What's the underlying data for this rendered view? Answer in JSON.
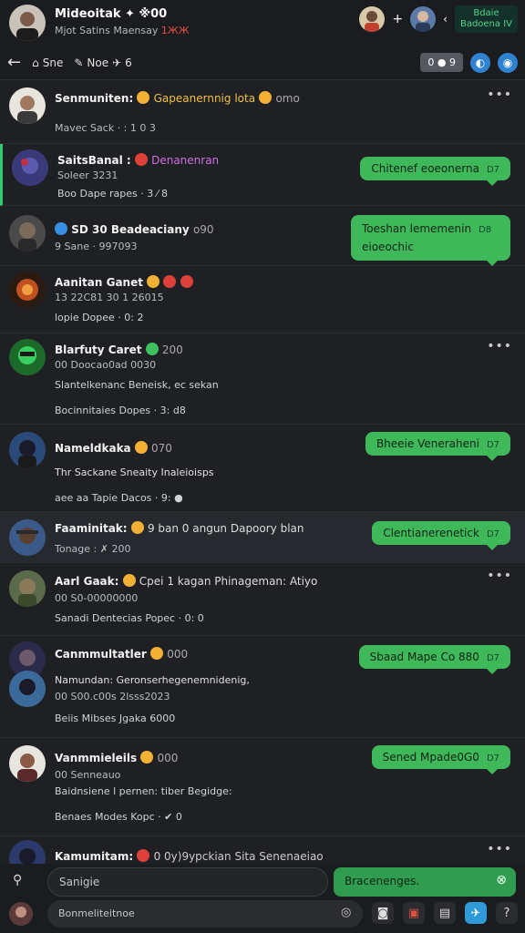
{
  "header": {
    "title": "Mideoitak ✦ ※00",
    "subtitle": "Mjot Satins Maensay",
    "subtitle_red": "1ЖЖ",
    "chip": "Bdaie\nBadoena IV"
  },
  "secbar": {
    "back_label": "←",
    "home_label": "Sne",
    "note_label": "Noe",
    "pill": "0 ● 9",
    "count": "6"
  },
  "rows": [
    {
      "name": "Senmuniten:",
      "tag": "Gapeanernnig lota",
      "tag2": "omo",
      "line2": "Mavec  Sack ·  : 1 0 3",
      "line3": "",
      "bubble": ""
    },
    {
      "name": "SaitsBanal :",
      "tag": "Denanenran",
      "line2": "Soleer 3231",
      "line3": "Boo  Dape  rapes · 3 ⁄ 8",
      "bubble": "Chitenef eoeonerna",
      "bubble_t": "D7"
    },
    {
      "name": "SD 30 Beadeaciany",
      "tag": "o90",
      "line2": "9 Sane · 997093",
      "line3": "",
      "bubble": "Toeshan lememenin",
      "bubble2": "eioeochic",
      "bubble_t": "D8"
    },
    {
      "name": "Aanitan Ganet",
      "tag": "",
      "line2": "13 22C81 30 1 26015",
      "line3": "lopie  Dopee · 0: 2",
      "bubble": ""
    },
    {
      "name": "Blarfuty Caret",
      "tag": "200",
      "line2": "00 Doocao0ad 0030",
      "line3a": "Slantelkenanc  Beneisk, ec  sekan",
      "line3": "Bocinnitaies  Dopes · 3: d8",
      "bubble": ""
    },
    {
      "name": "Nameldkaka",
      "tag": "070",
      "line2": "Thr Sackane Sneaity Inaleioisps",
      "line3": "aee aa  Tapie  Dacos · 9: ●",
      "bubble": "Bheeie Veneraheni",
      "bubble_t": "D7"
    },
    {
      "name": "Faaminitak:",
      "tag": "9 ban 0 angun  Dapoory blan",
      "line2": "Tonage : ✗ 200",
      "line3": "",
      "bubble": "Clentianerenetick",
      "bubble_t": "D7"
    },
    {
      "name": "Aarl Gaak:",
      "tag": "Cpei 1 kagan  Phinageman:  Atiyo",
      "line2": "00 S0-00000000",
      "line3": "Sanadi  Dentecias  Popec · 0: 0",
      "bubble": ""
    },
    {
      "name": "Canmmultatler",
      "tag": "000",
      "line2": "Namundan:  Geronserhegenemnidenig,",
      "line2b": "00 S00.c00s 2lsss2023",
      "line3": "Beiis  Mibses  Jgaka  6000",
      "bubble": "Sbaad Mape Co 880",
      "bubble_t": "D7"
    },
    {
      "name": "Vanmmieleils",
      "tag": "000",
      "line2": "00 Senneauo",
      "line3a": "Baidnsiene l pernen:  tiber  Begidge:",
      "line3": "Benaes  Modes  Kopc ·  ✔ 0",
      "bubble": "Sened Mpade0G0",
      "bubble_t": "D7"
    },
    {
      "name": "Kamumitam:",
      "tag": "0 0y)9ypckian Sita Senenaeiao",
      "line2": "",
      "line3": "",
      "bubble": ""
    }
  ],
  "bottom": {
    "compose_placeholder": "Sanigie",
    "send_label": "Bracenenges.",
    "search_placeholder": "Bonmeliteitnoe"
  }
}
